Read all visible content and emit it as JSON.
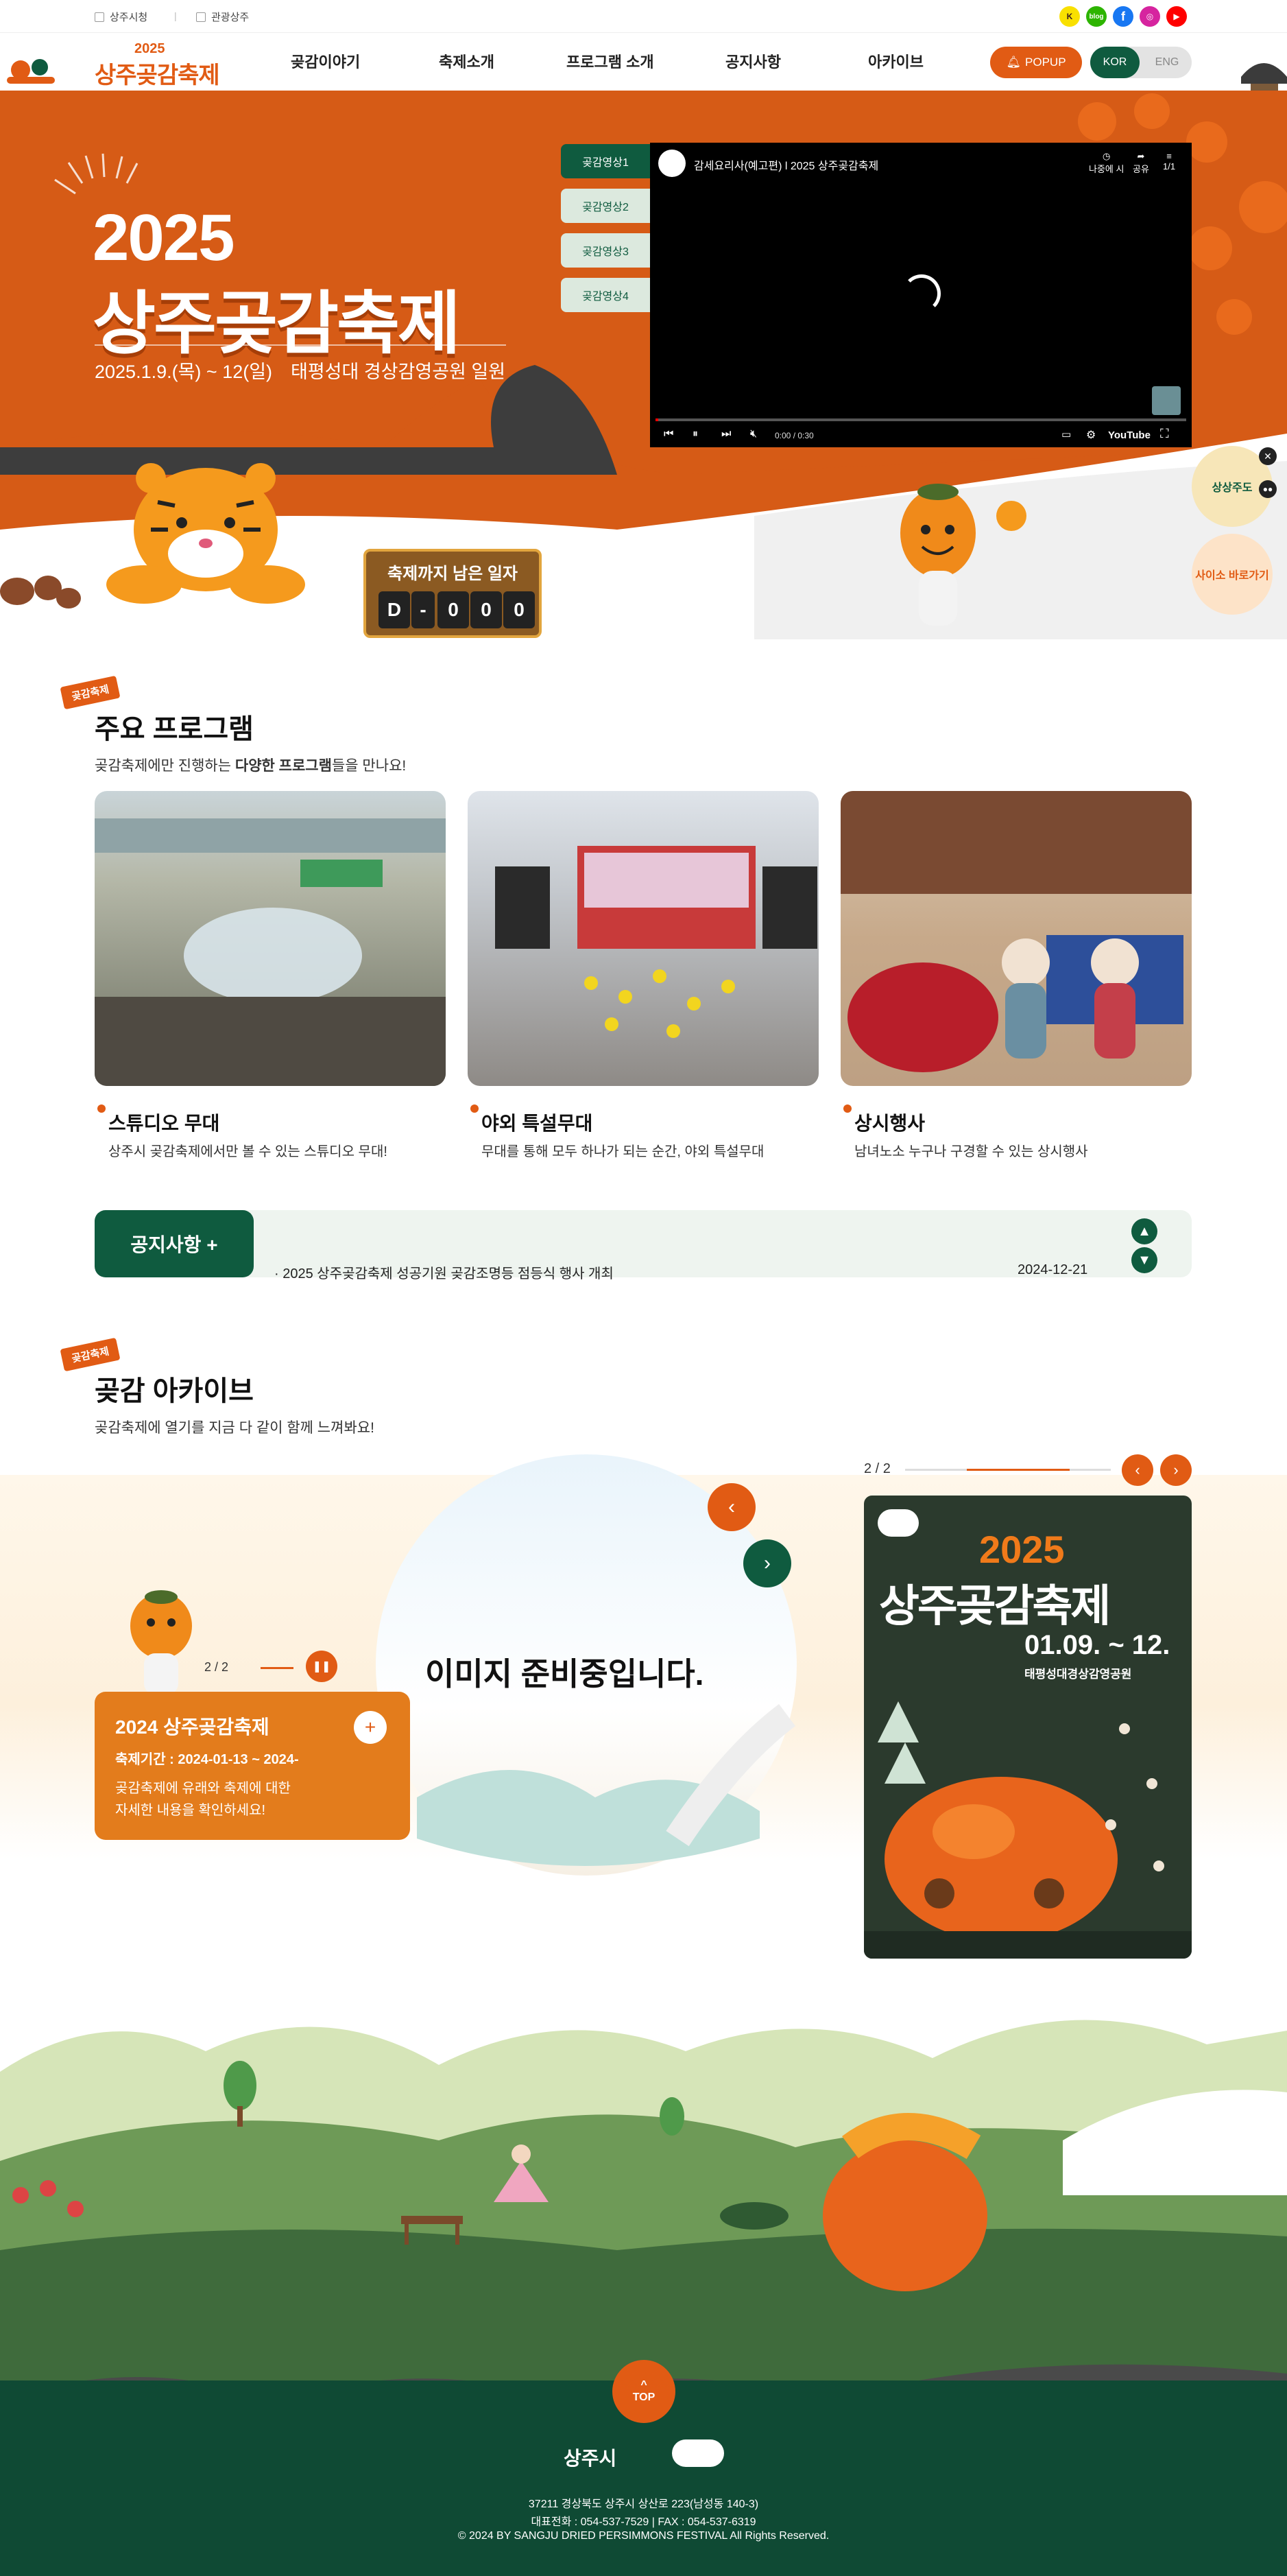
{
  "topbar": {
    "util_links": [
      "상주시청",
      "관광상주"
    ],
    "sns": [
      {
        "name": "kakao",
        "label": "K",
        "color": "#3c1e1e",
        "bg": "#f9e000"
      },
      {
        "name": "blog",
        "label": "blog",
        "color": "#ffffff",
        "bg": "#2db400"
      },
      {
        "name": "facebook",
        "label": "f",
        "color": "#ffffff",
        "bg": "#1877f2"
      },
      {
        "name": "instagram",
        "label": "◎",
        "color": "#ffffff",
        "bg": "#d6249f"
      },
      {
        "name": "youtube",
        "label": "▶",
        "color": "#ffffff",
        "bg": "#ff0000"
      }
    ]
  },
  "header": {
    "logo_year": "2025",
    "logo_name": "상주곶감축제",
    "nav": [
      "곶감이야기",
      "축제소개",
      "프로그램 소개",
      "공지사항",
      "아카이브"
    ],
    "popup_label": "POPUP",
    "lang_kor": "KOR",
    "lang_eng": "ENG"
  },
  "hero": {
    "year": "2025",
    "name": "상주곶감축제",
    "date": "2025.1.9.(목) ~ 12(일)",
    "venue": "태평성대 경상감영공원 일원",
    "video_tabs": [
      "곶감영상1",
      "곶감영상2",
      "곶감영상3",
      "곶감영상4"
    ],
    "video": {
      "title": "감세요리사(예고편) l 2025 상주곶감축제",
      "watch_later": "나중에 시",
      "share": "공유",
      "playlist": "1/1",
      "time": "0:00 / 0:30",
      "youtube": "YouTube"
    },
    "dday": {
      "label": "축제까지 남은 일자",
      "chars": [
        "D",
        "-",
        "0",
        "0",
        "0"
      ]
    },
    "side_badges": [
      "상상주도",
      "사이소 바로가기"
    ]
  },
  "programs": {
    "tag": "곶감축제",
    "title": "주요 프로그램",
    "desc_prefix": "곶감축제에만 진행하는 ",
    "desc_bold": "다양한 프로그램",
    "desc_suffix": "들을 만나요!",
    "items": [
      {
        "title": "스튜디오 무대",
        "desc": "상주시 곶감축제에서만 볼 수 있는 스튜디오 무대!"
      },
      {
        "title": "야외 특설무대",
        "desc": "무대를 통해 모두 하나가 되는 순간, 야외 특설무대"
      },
      {
        "title": "상시행사",
        "desc": "남녀노소 누구나 구경할 수 있는 상시행사"
      }
    ]
  },
  "notice": {
    "button": "공지사항 +",
    "item": "· 2025 상주곶감축제 성공기원 곶감조명등 점등식 행사 개최",
    "date": "2024-12-21"
  },
  "archive": {
    "tag": "곶감축제",
    "title": "곶감 아카이브",
    "desc": "곶감축제에 열기를 지금 다 같이 함께 느껴봐요!",
    "placeholder": "이미지 준비중입니다.",
    "pager": "2 / 2",
    "card_pager": "2 / 2",
    "card_title": "2024 상주곶감축제",
    "card_period": "축제기간 : 2024-01-13 ~ 2024-",
    "card_desc1": "곶감축제에 유래와 축제에 대한",
    "card_desc2": "자세한 내용을 확인하세요!",
    "poster": {
      "year": "2025",
      "name": "상주곶감축제",
      "date": "01.09. ~ 12.",
      "venue": "태평성대경상감영공원"
    }
  },
  "footer": {
    "top_label": "TOP",
    "org": "상주시",
    "address": "37211 경상북도 상주시 상산로 223(남성동 140-3)",
    "phone": "대표전화 : 054-537-7529 | FAX : 054-537-6319",
    "copyright": "© 2024 BY SANGJU DRIED PERSIMMONS FESTIVAL All Rights Reserved."
  }
}
